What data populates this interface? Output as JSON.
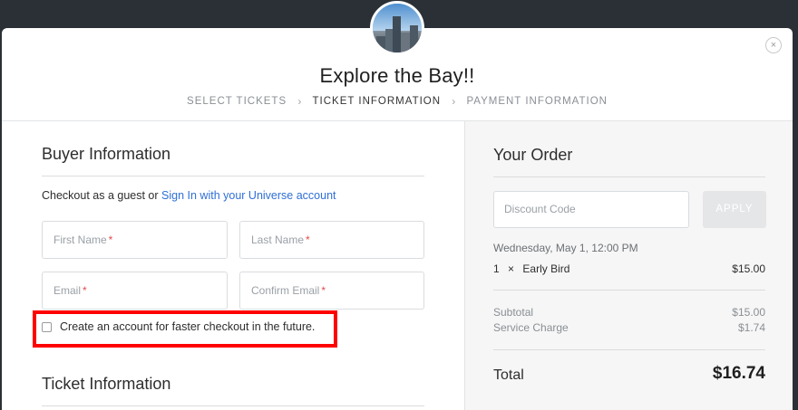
{
  "modal": {
    "close_glyph": "×",
    "event_title": "Explore the Bay!!",
    "steps": [
      {
        "label": "SELECT TICKETS"
      },
      {
        "label": "TICKET INFORMATION"
      },
      {
        "label": "PAYMENT INFORMATION"
      }
    ],
    "active_step": "TICKET INFORMATION",
    "step_separator": "›"
  },
  "buyer": {
    "section_title": "Buyer Information",
    "guest_prefix": "Checkout as a guest or ",
    "sign_in_link": "Sign In with your Universe account",
    "fields": {
      "first_name": {
        "label": "First Name",
        "required_mark": "*"
      },
      "last_name": {
        "label": "Last Name",
        "required_mark": "*"
      },
      "email": {
        "label": "Email",
        "required_mark": "*"
      },
      "confirm_email": {
        "label": "Confirm Email",
        "required_mark": "*"
      }
    },
    "create_account_label": "Create an account for faster checkout in the future.",
    "create_account_checked": false
  },
  "ticket": {
    "section_title": "Ticket Information"
  },
  "order": {
    "title": "Your Order",
    "discount_placeholder": "Discount Code",
    "apply_label": "APPLY",
    "date": "Wednesday, May 1, 12:00 PM",
    "items": [
      {
        "qty": "1",
        "times": "×",
        "name": "Early Bird",
        "price": "$15.00"
      }
    ],
    "subtotal_label": "Subtotal",
    "subtotal_value": "$15.00",
    "service_label": "Service Charge",
    "service_value": "$1.74",
    "total_label": "Total",
    "total_value": "$16.74"
  },
  "colors": {
    "backdrop": "#2b3036",
    "link": "#2f6fd6",
    "required": "#e34b4b",
    "highlight": "#ff0000",
    "apply_bg": "#e4e6e8"
  }
}
